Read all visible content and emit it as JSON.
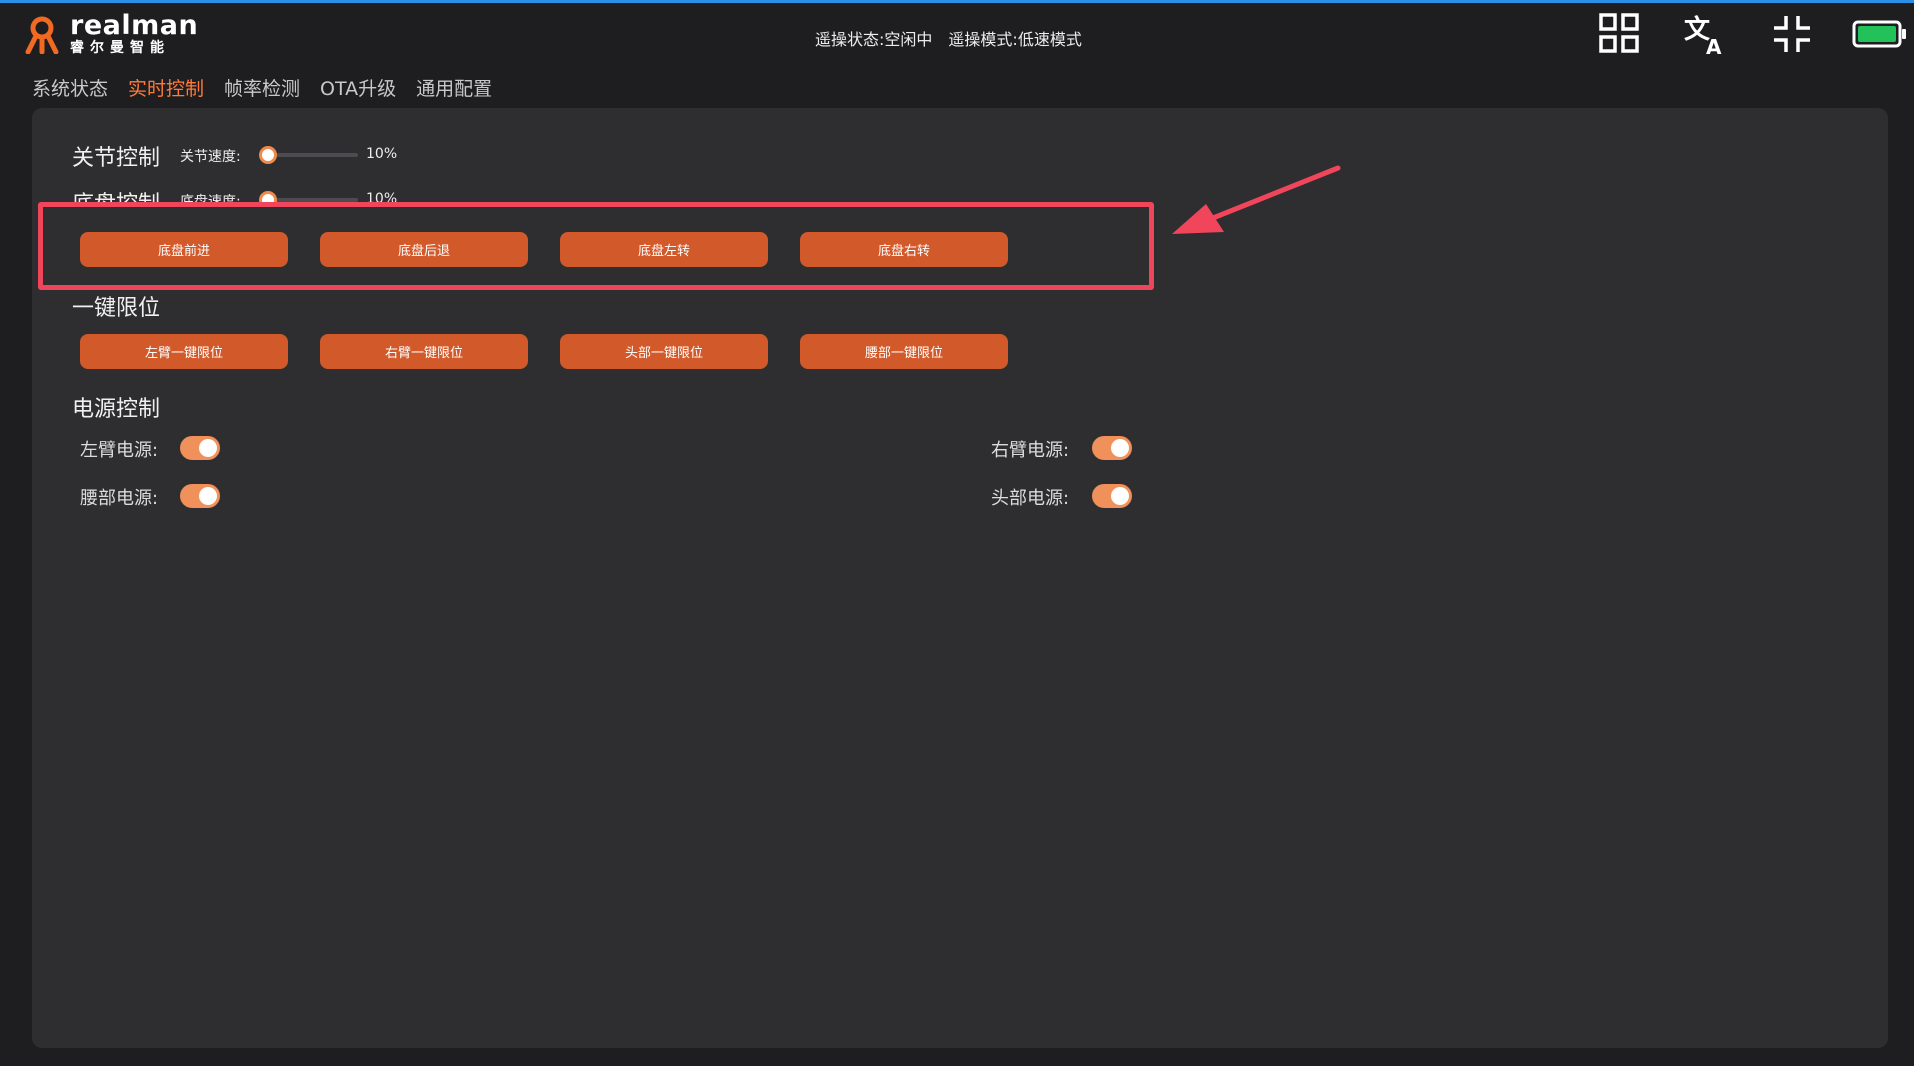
{
  "brand": {
    "name_en": "realman",
    "name_cn": "睿尔曼智能"
  },
  "header": {
    "teleop_status_label": "遥操状态:",
    "teleop_status_value": "空闲中",
    "teleop_mode_label": "遥操模式:",
    "teleop_mode_value": "低速模式",
    "icons": [
      "grid-icon",
      "translate-icon",
      "exit-fullscreen-icon",
      "battery-icon"
    ],
    "battery_level": 1.0
  },
  "tabs": [
    {
      "label": "系统状态",
      "active": false
    },
    {
      "label": "实时控制",
      "active": true
    },
    {
      "label": "帧率检测",
      "active": false
    },
    {
      "label": "OTA升级",
      "active": false
    },
    {
      "label": "通用配置",
      "active": false
    }
  ],
  "joint_control": {
    "title": "关节控制",
    "speed_label": "关节速度:",
    "speed_value": "10%",
    "speed_fraction": 0.1
  },
  "chassis_control": {
    "title": "底盘控制",
    "speed_label": "底盘速度:",
    "speed_value": "10%",
    "speed_fraction": 0.1,
    "buttons": [
      "底盘前进",
      "底盘后退",
      "底盘左转",
      "底盘右转"
    ]
  },
  "one_key_limit": {
    "title": "一键限位",
    "buttons": [
      "左臂一键限位",
      "右臂一键限位",
      "头部一键限位",
      "腰部一键限位"
    ]
  },
  "power_control": {
    "title": "电源控制",
    "left_arm": {
      "label": "左臂电源:",
      "on": true
    },
    "right_arm": {
      "label": "右臂电源:",
      "on": true
    },
    "waist": {
      "label": "腰部电源:",
      "on": true
    },
    "head": {
      "label": "头部电源:",
      "on": true
    }
  },
  "colors": {
    "accent": "#d2592a",
    "active_tab": "#ff7a3a",
    "annotation": "#f0455a",
    "battery": "#22c15a"
  }
}
